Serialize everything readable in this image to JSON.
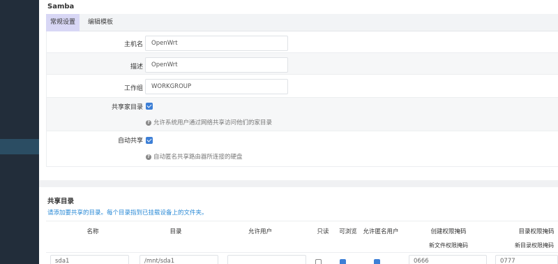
{
  "panel": {
    "title": "Samba",
    "tabs": [
      {
        "label": "常规设置",
        "active": true
      },
      {
        "label": "编辑模板",
        "active": false
      }
    ]
  },
  "general": {
    "hostname": {
      "label": "主机名",
      "value": "OpenWrt"
    },
    "description": {
      "label": "描述",
      "value": "OpenWrt"
    },
    "workgroup": {
      "label": "工作组",
      "value": "WORKGROUP"
    },
    "share_homes": {
      "label": "共享家目录",
      "checked": true,
      "hint": "允许系统用户通过网络共享访问他们的家目录"
    },
    "auto_share": {
      "label": "自动共享",
      "checked": true,
      "hint": "自动匿名共享路由器所连接的硬盘"
    }
  },
  "shares": {
    "title": "共享目录",
    "description": "请添加要共享的目录。每个目录指到已挂载设备上的文件夹。",
    "columns": {
      "name": "名称",
      "path": "目录",
      "users": "允许用户",
      "read_only": "只读",
      "browseable": "可浏览",
      "guest_ok": "允许匿名用户",
      "create_mask": "创建权限掩码",
      "create_mask_sub": "新文件权限掩码",
      "dir_mask": "目录权限掩码",
      "dir_mask_sub": "新目录权限掩码"
    },
    "rows": [
      {
        "name": "sda1",
        "path": "/mnt/sda1",
        "users": "",
        "read_only": false,
        "browseable": true,
        "guest_ok": true,
        "create_mask": "0666",
        "dir_mask": "0777"
      }
    ]
  },
  "colors": {
    "accent": "#3d7fd6",
    "active_tab": "#d8d7f5",
    "sidebar": "#222d3a",
    "hint_link": "#2a8ad6"
  }
}
